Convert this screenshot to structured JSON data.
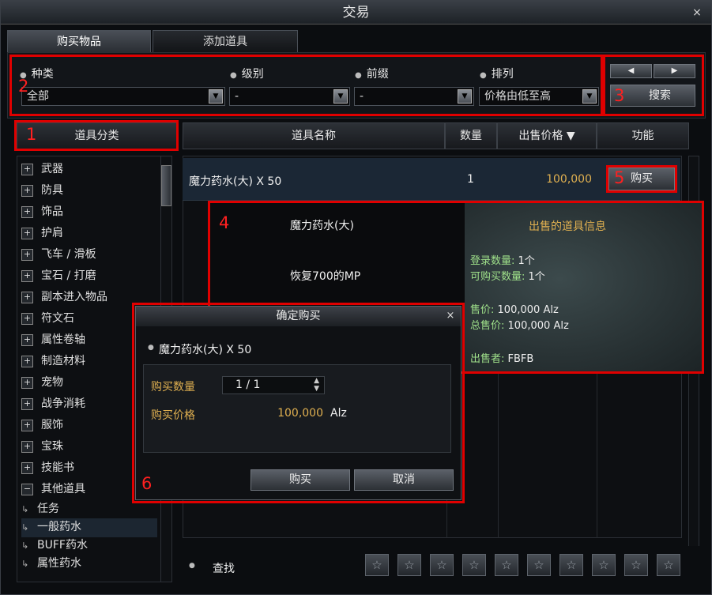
{
  "window": {
    "title": "交易",
    "close": "×"
  },
  "tabs": [
    {
      "label": "购买物品"
    },
    {
      "label": "添加道具"
    }
  ],
  "filters": {
    "category": {
      "label": "种类",
      "value": "全部"
    },
    "level": {
      "label": "级别",
      "value": "-"
    },
    "prefix": {
      "label": "前缀",
      "value": "-"
    },
    "sort": {
      "label": "排列",
      "value": "价格由低至高"
    }
  },
  "pager": {
    "prev": "◀",
    "next": "▶"
  },
  "search_button": "搜索",
  "annotations": [
    "1",
    "2",
    "3",
    "4",
    "5",
    "6"
  ],
  "columns": {
    "category": "道具分类",
    "name": "道具名称",
    "qty": "数量",
    "price": "出售价格 ▼",
    "action": "功能"
  },
  "categories": [
    {
      "label": "武器",
      "sign": "+"
    },
    {
      "label": "防具",
      "sign": "+"
    },
    {
      "label": "饰品",
      "sign": "+"
    },
    {
      "label": "护肩",
      "sign": "+"
    },
    {
      "label": "飞车 / 滑板",
      "sign": "+"
    },
    {
      "label": "宝石 / 打磨",
      "sign": "+"
    },
    {
      "label": "副本进入物品",
      "sign": "+"
    },
    {
      "label": "符文石",
      "sign": "+"
    },
    {
      "label": "属性卷轴",
      "sign": "+"
    },
    {
      "label": "制造材料",
      "sign": "+"
    },
    {
      "label": "宠物",
      "sign": "+"
    },
    {
      "label": "战争消耗",
      "sign": "+"
    },
    {
      "label": "服饰",
      "sign": "+"
    },
    {
      "label": "宝珠",
      "sign": "+"
    },
    {
      "label": "技能书",
      "sign": "+"
    },
    {
      "label": "其他道具",
      "sign": "−"
    }
  ],
  "subcategories": [
    {
      "label": "任务",
      "arrow": "↳"
    },
    {
      "label": "一般药水",
      "arrow": "↳"
    },
    {
      "label": "BUFF药水",
      "arrow": "↳"
    },
    {
      "label": "属性药水",
      "arrow": "↳"
    }
  ],
  "listing": {
    "name": "魔力药水(大) X 50",
    "qty": "1",
    "price": "100,000",
    "buy": "购买"
  },
  "tooltip": {
    "item_name": "魔力药水(大)",
    "effect": "恢复700的MP",
    "header": "出售的道具信息",
    "reg_qty_label": "登录数量:",
    "reg_qty": "1个",
    "buyable_label": "可购买数量:",
    "buyable": "1个",
    "price_label": "售价:",
    "price": "100,000",
    "currency": "Alz",
    "total_label": "总售价:",
    "total": "100,000",
    "seller_label": "出售者:",
    "seller": "FBFB"
  },
  "dialog": {
    "title": "确定购买",
    "close": "×",
    "item": "魔力药水(大) X 50",
    "qty_label": "购买数量",
    "qty_value": "1 / 1",
    "price_label": "购买价格",
    "price": "100,000",
    "currency": "Alz",
    "confirm": "购买",
    "cancel": "取消"
  },
  "footer": {
    "search_label": "查找",
    "star": "☆"
  },
  "colors": {
    "annotation": "#e00000",
    "price": "#e0b050",
    "info": "#9fe08a"
  }
}
